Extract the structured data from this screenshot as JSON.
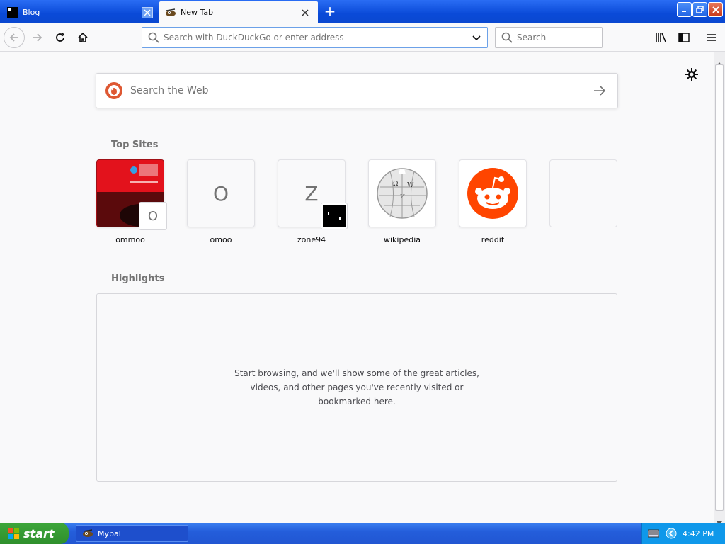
{
  "tabs": [
    {
      "label": "Blog",
      "active": false
    },
    {
      "label": "New Tab",
      "active": true
    }
  ],
  "urlbar": {
    "placeholder": "Search with DuckDuckGo or enter address"
  },
  "searchbar": {
    "placeholder": "Search"
  },
  "web_search": {
    "placeholder": "Search the Web"
  },
  "top_sites": {
    "title": "Top Sites",
    "tiles": [
      {
        "label": "ommoo",
        "letter": "O"
      },
      {
        "label": "omoo",
        "letter": "O"
      },
      {
        "label": "zone94",
        "letter": "Z"
      },
      {
        "label": "wikipedia",
        "letter": ""
      },
      {
        "label": "reddit",
        "letter": ""
      },
      {
        "label": "",
        "letter": ""
      }
    ]
  },
  "highlights": {
    "title": "Highlights",
    "empty_message": "Start browsing, and we'll show some of the great articles, videos, and other pages you've recently visited or bookmarked here."
  },
  "taskbar": {
    "start_label": "start",
    "items": [
      {
        "label": "Mypal"
      }
    ],
    "clock": "4:42 PM"
  },
  "colors": {
    "accent": "#0a4ad8",
    "reddit": "#ff4500",
    "start_green": "#3da63a"
  }
}
